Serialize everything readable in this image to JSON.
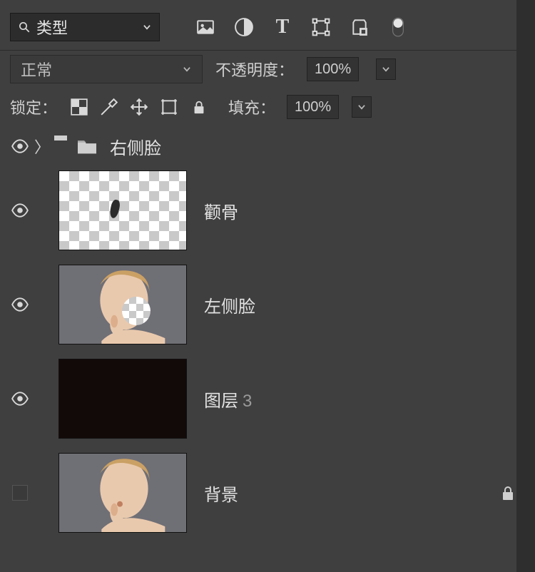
{
  "filter": {
    "label": "类型",
    "icons": {
      "image": "image-filter",
      "adjust": "adjustment-filter",
      "text": "text-filter",
      "shape": "shape-filter",
      "smart": "smart-filter",
      "toggle": "filter-toggle"
    }
  },
  "blend": {
    "mode": "正常",
    "opacity_label": "不透明度：",
    "opacity_value": "100%"
  },
  "lock": {
    "label": "锁定：",
    "fill_label": "填充：",
    "fill_value": "100%"
  },
  "layers": [
    {
      "type": "group",
      "visible": true,
      "name": "右侧脸"
    },
    {
      "type": "layer",
      "visible": true,
      "thumb": "checker-smudge",
      "name": "颧骨"
    },
    {
      "type": "layer",
      "visible": true,
      "thumb": "portrait-hole",
      "name": "左侧脸"
    },
    {
      "type": "layer",
      "visible": true,
      "thumb": "dark",
      "name": "图层",
      "suffix": "3"
    },
    {
      "type": "layer",
      "visible": false,
      "thumb": "portrait",
      "name": "背景",
      "locked": true
    }
  ]
}
